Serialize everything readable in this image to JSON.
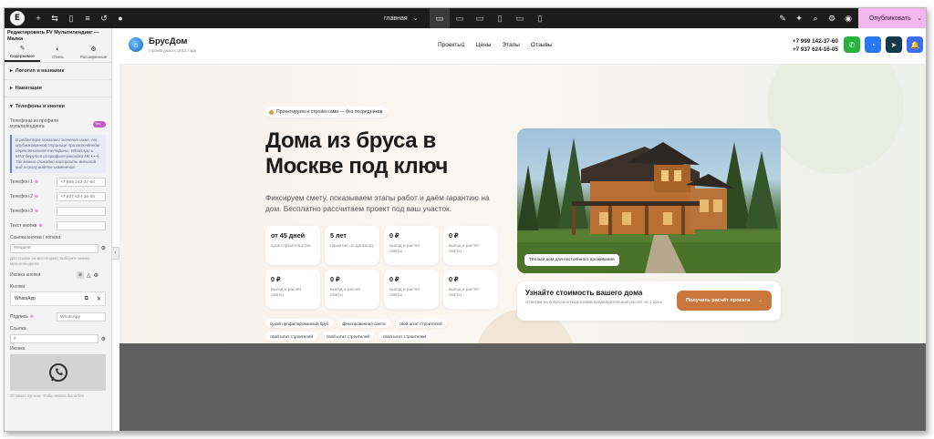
{
  "topbar": {
    "page_label": "главная",
    "publish_label": "Опубликовать"
  },
  "panel": {
    "title": "Редактировать FV Мультилендинг — Малка",
    "tabs": [
      {
        "label": "Содержимое",
        "icon": "pencil-icon"
      },
      {
        "label": "Стиль",
        "icon": "contrast-icon"
      },
      {
        "label": "Расширенные",
        "icon": "gear-icon"
      }
    ],
    "sections": [
      {
        "label": "Логотип и название"
      },
      {
        "label": "Навигация"
      },
      {
        "label": "Телефоны и кнопки"
      }
    ],
    "phones_toggle_label": "Телефоны из профиля мультилендинга",
    "phones_toggle_value": "Yes",
    "note": "В редакторе показаны значения ниже. На опубликованной странице при включённом переключателе телефоны, WhatsApp и MAX берутся из профиля (вкладка Мс • • •). Так можно спокойно настроить внешний вид и сразу видеть изменения.",
    "fields": [
      {
        "label": "Телефон 1",
        "value": "+7 999 142-37-60"
      },
      {
        "label": "Телефон 2",
        "value": "+7 937 624-16-05"
      },
      {
        "label": "Телефон 3",
        "value": ""
      },
      {
        "label": "Текст кнопки",
        "value": ""
      }
    ],
    "button_link_label": "Ссылка кнопки / попапа",
    "button_link_value": "#request",
    "button_link_hint": "Для ссылки на мессенджер выберите иконку мультилендинга",
    "button_icon_label": "Иконка кнопки",
    "buttons_label": "Кнопки",
    "button_item_name": "WhatsApp",
    "caption_label": "Подпись",
    "caption_value": "WhatsApp",
    "link_label": "Ссылка",
    "link_value": "#",
    "icon_label": "Иконка",
    "icon_hint": "Оставьте пустым, чтобы иконка была без"
  },
  "site": {
    "brand_name": "БрусДом",
    "brand_sub": "строим дома с 2012 года",
    "nav": [
      "Проекты1",
      "Цены",
      "Этапы",
      "Отзывы"
    ],
    "phone1": "+7 999 142-37-60",
    "phone2": "+7 937 624-16-05",
    "header_buttons": [
      {
        "icon": "whatsapp-icon",
        "color": "#25b33b"
      },
      {
        "icon": "max-chat-icon",
        "color": "#2a78f0"
      },
      {
        "icon": "telegram-icon",
        "color": "#15394d"
      },
      {
        "icon": "bell-icon",
        "color": "#3b6ef0"
      }
    ]
  },
  "hero": {
    "pill": "Проектируем и строим сами — без посредников",
    "title": "Дома из бруса в Москве под ключ",
    "lead": "Фиксируем смету, показываем этапы работ и даём гарантию на дом. Бесплатно рассчитаем проект под ваш участок.",
    "stats": [
      {
        "value": "от 45 дней",
        "desc": "срок строительства"
      },
      {
        "value": "5 лет",
        "desc": "гарантия по договору"
      },
      {
        "value": "0 ₽",
        "desc": "выезд и расчёт сметы"
      },
      {
        "value": "0 ₽",
        "desc": "выезд и расчёт сметы"
      },
      {
        "value": "0 ₽",
        "desc": "выезд и расчёт сметы"
      },
      {
        "value": "0 ₽",
        "desc": "выезд и расчёт сметы"
      },
      {
        "value": "0 ₽",
        "desc": "выезд и расчёт сметы"
      },
      {
        "value": "0 ₽",
        "desc": "выезд и расчёт сметы"
      }
    ],
    "tags": [
      "сухой профилированный брус",
      "фиксированная смета",
      "свой штат строителей",
      "свой штат строителей",
      "свой штат строителей",
      "свой штат строителей"
    ],
    "photo_caption": "Тёплый дом для постоянного проживания",
    "cta_title": "Узнайте стоимость вашего дома",
    "cta_desc": "Ответим на вопросы и подготовим предварительный расчёт за 1 день.",
    "cta_button": "Получить расчёт проекта",
    "cta_arrow": "→"
  },
  "colors": {
    "accent_pink": "#c35ac0",
    "cta_orange": "#c8783d",
    "topbar": "#1c1c1c"
  }
}
